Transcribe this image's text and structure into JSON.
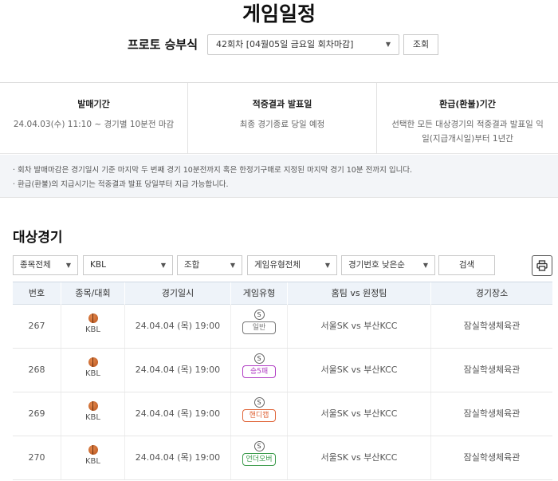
{
  "page": {
    "title": "게임일정"
  },
  "round": {
    "label": "프로토 승부식",
    "selected": "42회차 [04월05일 금요일 회차마감]",
    "button": "조회"
  },
  "info": [
    {
      "title": "발매기간",
      "text": "24.04.03(수) 11:10 ~ 경기별 10분전 마감"
    },
    {
      "title": "적중결과 발표일",
      "text": "최종 경기종료 당일 예정"
    },
    {
      "title": "환급(환불)기간",
      "text": "선택한 모든 대상경기의 적중결과 발표일 익일(지급개시일)부터 1년간"
    }
  ],
  "notice": [
    "· 회차 발매마감은 경기일시 기준 마지막 두 번째 경기 10분전까지 혹은 한정기구매로 지정된 마지막 경기 10분 전까지 입니다.",
    "· 환급(환불)의 지급시기는 적중결과 발표 당일부터 지급 가능합니다."
  ],
  "section": {
    "title": "대상경기"
  },
  "filters": {
    "sport": "종목전체",
    "league": "KBL",
    "combo": "조합",
    "game_type": "게임유형전체",
    "sort": "경기번호 낮은순",
    "search": "검색"
  },
  "table": {
    "headers": [
      "번호",
      "종목/대회",
      "경기일시",
      "게임유형",
      "홈팀 vs 원정팀",
      "경기장소"
    ],
    "rows": [
      {
        "no": "267",
        "league": "KBL",
        "datetime": "24.04.04 (목) 19:00",
        "mark": "S",
        "type": "일반",
        "type_color": "#777777",
        "match": "서울SK vs 부산KCC",
        "venue": "잠실학생체육관"
      },
      {
        "no": "268",
        "league": "KBL",
        "datetime": "24.04.04 (목) 19:00",
        "mark": "S",
        "type": "승5패",
        "type_color": "#b03dc4",
        "match": "서울SK vs 부산KCC",
        "venue": "잠실학생체육관"
      },
      {
        "no": "269",
        "league": "KBL",
        "datetime": "24.04.04 (목) 19:00",
        "mark": "S",
        "type": "핸디캡",
        "type_color": "#e0663a",
        "match": "서울SK vs 부산KCC",
        "venue": "잠실학생체육관"
      },
      {
        "no": "270",
        "league": "KBL",
        "datetime": "24.04.04 (목) 19:00",
        "mark": "S",
        "type": "언더오버",
        "type_color": "#3a9a4a",
        "match": "서울SK vs 부산KCC",
        "venue": "잠실학생체육관"
      }
    ]
  }
}
